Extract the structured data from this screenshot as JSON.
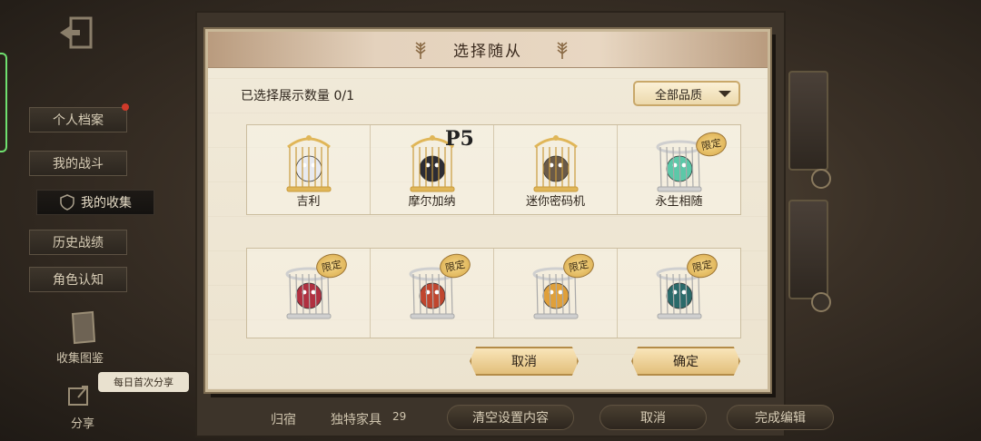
{
  "background": {
    "side_menu": [
      {
        "label": "个人档案",
        "icon": "profile-tab"
      },
      {
        "label": "我的战斗",
        "icon": "battle-tab"
      },
      {
        "label": "我的收集",
        "icon": "shield-icon",
        "active": true
      },
      {
        "label": "历史战绩",
        "icon": "history-tab"
      },
      {
        "label": "角色认知",
        "icon": "character-tab"
      }
    ],
    "collection_album_label": "收集图鉴",
    "share_label": "分享",
    "daily_share_bubble": "每日首次分享",
    "bottom_bar": {
      "dorm_label": "归宿",
      "furniture_label": "独特家具",
      "furniture_count": "29",
      "clear_button": "清空设置内容",
      "cancel_button": "取消",
      "finish_button": "完成编辑"
    }
  },
  "modal": {
    "title": "选择随从",
    "selection_count_label": "已选择展示数量 0/1",
    "filter": {
      "selected": "全部品质"
    },
    "limited_badge": "限定",
    "pets": [
      {
        "name": "吉利",
        "cage": "gold",
        "limited": false,
        "creature_color": "#e8eaf0"
      },
      {
        "name": "摩尔加纳",
        "cage": "gold",
        "limited": false,
        "creature_color": "#2c2c34",
        "logo": "P5"
      },
      {
        "name": "迷你密码机",
        "cage": "gold",
        "limited": false,
        "creature_color": "#6a5a48"
      },
      {
        "name": "永生相随",
        "cage": "silver",
        "limited": true,
        "creature_color": "#5cc8a8"
      },
      {
        "name": "",
        "cage": "silver",
        "limited": true,
        "creature_color": "#b03040"
      },
      {
        "name": "",
        "cage": "silver",
        "limited": true,
        "creature_color": "#c0462e"
      },
      {
        "name": "",
        "cage": "silver",
        "limited": true,
        "creature_color": "#e0a03a"
      },
      {
        "name": "",
        "cage": "silver",
        "limited": true,
        "creature_color": "#2a6a6a"
      }
    ],
    "cancel_button": "取消",
    "confirm_button": "确定"
  }
}
